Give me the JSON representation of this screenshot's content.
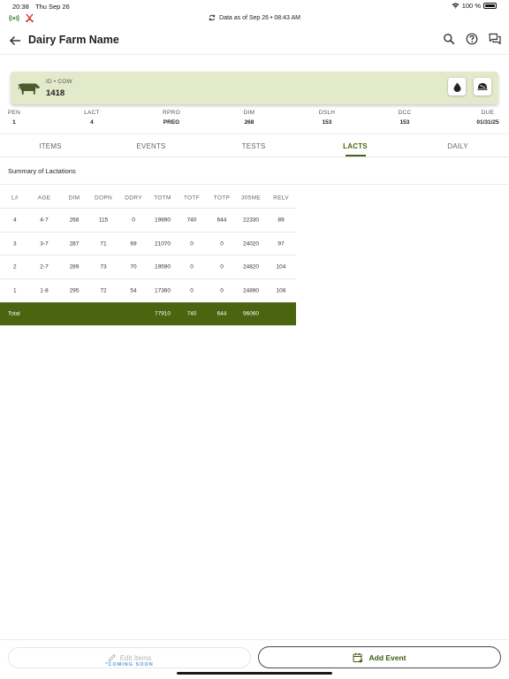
{
  "status_bar": {
    "time": "20:38",
    "date": "Thu Sep 26",
    "battery": "100 %"
  },
  "sync": {
    "text": "Data as of Sep 26 • 08:43 AM"
  },
  "app_bar": {
    "title": "Dairy Farm Name"
  },
  "animal": {
    "type_label": "ID • COW",
    "id": "1418"
  },
  "stats": [
    {
      "label": "PEN",
      "value": "1"
    },
    {
      "label": "LACT",
      "value": "4"
    },
    {
      "label": "RPRO",
      "value": "PREG"
    },
    {
      "label": "DIM",
      "value": "268"
    },
    {
      "label": "DSLH",
      "value": "153"
    },
    {
      "label": "DCC",
      "value": "153"
    },
    {
      "label": "DUE",
      "value": "01/31/25"
    }
  ],
  "tabs": [
    "ITEMS",
    "EVENTS",
    "TESTS",
    "LACTS",
    "DAILY"
  ],
  "active_tab": "LACTS",
  "summary": {
    "title": "Summary of Lactations"
  },
  "table": {
    "headers": [
      "L#",
      "AGE",
      "DIM",
      "DOPN",
      "DDRY",
      "TOTM",
      "TOTF",
      "TOTP",
      "305ME",
      "RELV"
    ],
    "rows": [
      [
        "4",
        "4-7",
        "268",
        "115",
        "0",
        "19890",
        "740",
        "644",
        "22330",
        "89"
      ],
      [
        "3",
        "3-7",
        "287",
        "71",
        "69",
        "21070",
        "0",
        "0",
        "24020",
        "97"
      ],
      [
        "2",
        "2-7",
        "289",
        "73",
        "70",
        "19590",
        "0",
        "0",
        "24820",
        "104"
      ],
      [
        "1",
        "1-8",
        "295",
        "72",
        "54",
        "17360",
        "0",
        "0",
        "24890",
        "108"
      ]
    ],
    "total": {
      "label": "Total",
      "totm": "77910",
      "totf": "740",
      "totp": "644",
      "me305": "96060"
    }
  },
  "bottom": {
    "edit_label": "Edit Items",
    "coming_soon": "*COMING SOON",
    "add_label": "Add Event"
  },
  "colors": {
    "accent": "#4a6410",
    "card_bg": "#e3e9cb"
  }
}
